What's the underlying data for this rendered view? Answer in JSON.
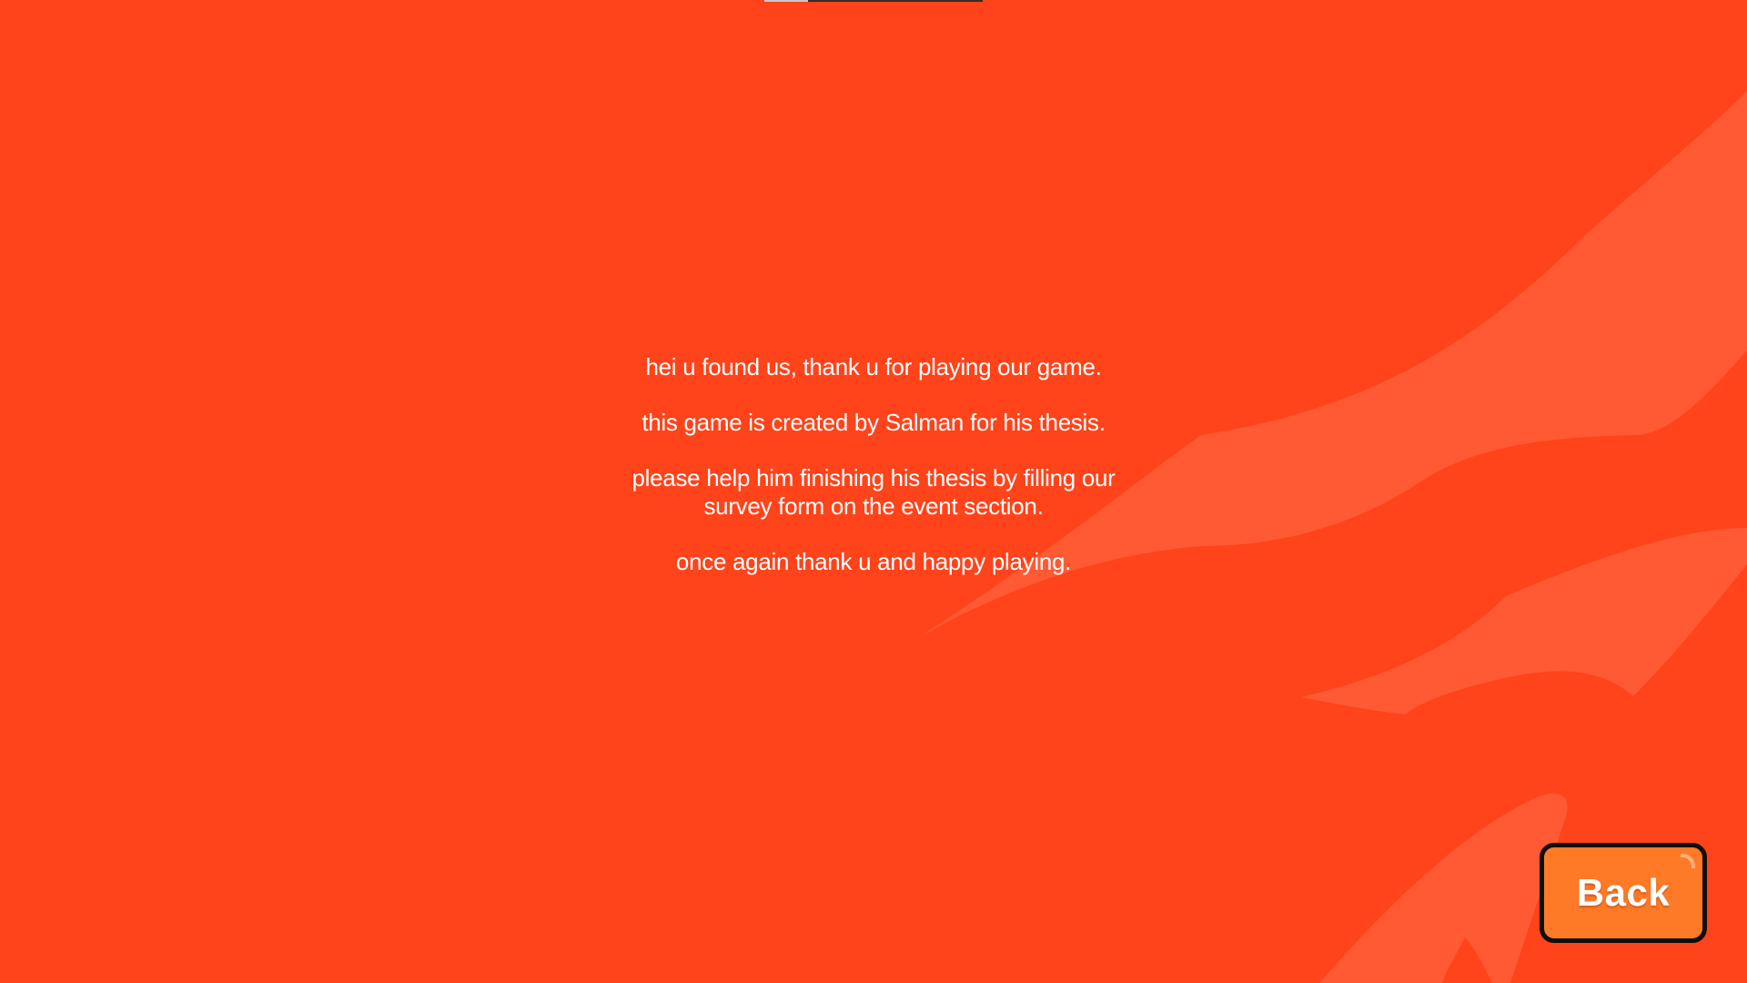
{
  "screen": {
    "background_color": "#ff431a",
    "accent_shape_color": "#ff5a33"
  },
  "message": {
    "lines": [
      "hei u found us, thank u for playing our game.",
      "this game is created by Salman for his thesis.",
      "please help him finishing his thesis by filling our\nsurvey form on the event section.",
      "once again thank u and happy playing."
    ]
  },
  "back_button": {
    "label": "Back",
    "fill_color": "#ff7a26",
    "border_color": "#0e0e0e"
  }
}
